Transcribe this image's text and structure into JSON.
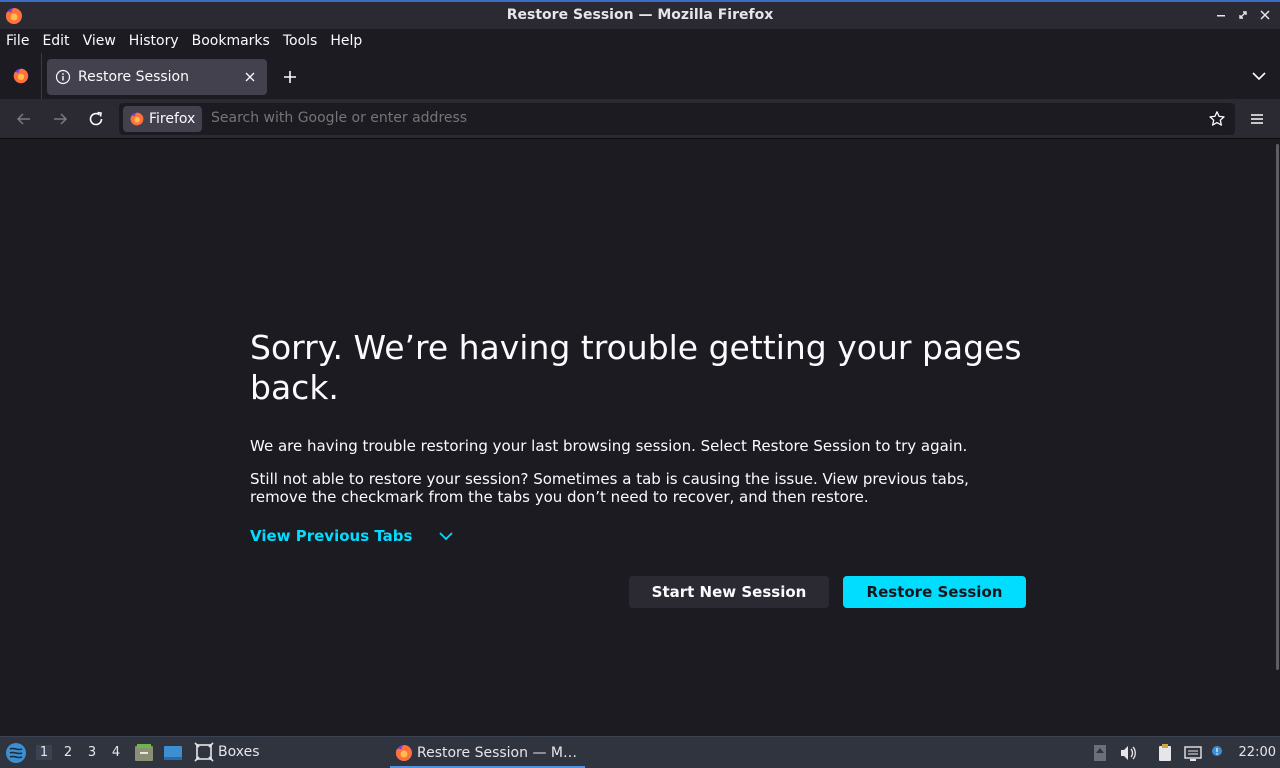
{
  "window": {
    "title": "Restore Session — Mozilla Firefox"
  },
  "menu": [
    "File",
    "Edit",
    "View",
    "History",
    "Bookmarks",
    "Tools",
    "Help"
  ],
  "tab": {
    "label": "Restore Session"
  },
  "urlbar": {
    "identity_label": "Firefox",
    "placeholder": "Search with Google or enter address"
  },
  "page": {
    "title": "Sorry. We’re having trouble getting your pages back.",
    "paragraph1": "We are having trouble restoring your last browsing session. Select Restore Session to try again.",
    "paragraph2": "Still not able to restore your session? Sometimes a tab is causing the issue. View previous tabs, remove the checkmark from the tabs you don’t need to recover, and then restore.",
    "view_previous_tabs": "View Previous Tabs",
    "start_new_session": "Start New Session",
    "restore_session": "Restore Session"
  },
  "taskbar": {
    "workspaces": [
      "1",
      "2",
      "3",
      "4"
    ],
    "boxes_label": "Boxes",
    "task_label": "Restore Session — M…",
    "clock": "22:00"
  },
  "colors": {
    "accent": "#00ddff",
    "background": "#1c1b22",
    "toolbar": "#2b2a33"
  }
}
